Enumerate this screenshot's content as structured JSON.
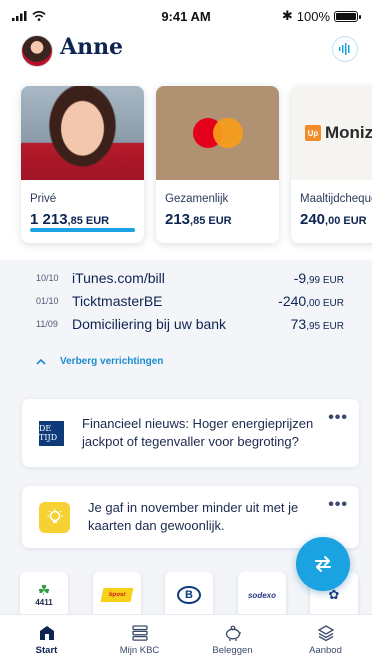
{
  "status_bar": {
    "time": "9:41 AM",
    "battery": "100%"
  },
  "header": {
    "user_name": "Anne"
  },
  "accounts": [
    {
      "label": "Privé",
      "balance_main": "1 213",
      "balance_small": ",85 EUR"
    },
    {
      "label": "Gezamenlijk",
      "balance_main": "213",
      "balance_small": ",85 EUR"
    },
    {
      "label": "Maaltijdcheques",
      "balance_main": "240",
      "balance_small": ",00 EUR",
      "brand_box": "Up",
      "brand_text": "Moniz"
    }
  ],
  "transactions": [
    {
      "date": "10/10",
      "name": "iTunes.com/bill",
      "amount_main": "-9",
      "amount_small": ",99 EUR"
    },
    {
      "date": "01/10",
      "name": "TicktmasterBE",
      "amount_main": "-240",
      "amount_small": ",00 EUR"
    },
    {
      "date": "11/09",
      "name": "Domiciliering bij uw bank",
      "amount_main": "73",
      "amount_small": ",95 EUR"
    }
  ],
  "hide_transactions_label": "Verberg verrichtingen",
  "news": [
    {
      "logo": "DE TIJD",
      "text": "Financieel nieuws: Hoger energieprijzen jackpot of tegenvaller voor begroting?",
      "menu": "•••"
    },
    {
      "text": "Je gaf in november minder uit met je kaarten dan gewoonlijk.",
      "menu": "•••"
    }
  ],
  "partners": {
    "lotto_text": "4411",
    "post_text": "bpost",
    "nmbs_text": "B",
    "sodexo_text": "sodexo"
  },
  "bottom_nav": [
    {
      "label": "Start",
      "icon": "bank-icon",
      "active": true
    },
    {
      "label": "Mijn KBC",
      "icon": "list-icon",
      "active": false
    },
    {
      "label": "Beleggen",
      "icon": "piggy-bank-icon",
      "active": false
    },
    {
      "label": "Aanbod",
      "icon": "layers-icon",
      "active": false
    }
  ],
  "colors": {
    "accent": "#1aa3e0",
    "navy": "#0e2452",
    "background": "#f3f5f8"
  }
}
